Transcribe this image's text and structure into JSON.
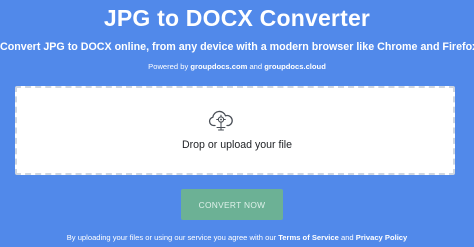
{
  "header": {
    "title": "JPG to DOCX Converter",
    "subtitle": "Convert JPG to DOCX online, from any device with a modern browser like Chrome and Firefox.",
    "powered_prefix": "Powered by ",
    "powered_link1": "groupdocs.com",
    "powered_and": " and ",
    "powered_link2": "groupdocs.cloud"
  },
  "upload": {
    "label": "Drop or upload your file",
    "icon": "cloud-upload-icon"
  },
  "actions": {
    "convert_label": "CONVERT NOW"
  },
  "footer": {
    "prefix": "By uploading your files or using our service you agree with our ",
    "terms_link": "Terms of Service",
    "and": " and ",
    "privacy_link": "Privacy Policy"
  },
  "colors": {
    "background": "#5189ea",
    "convert_button": "#6cb195",
    "dropzone_border": "#cfd6e0"
  }
}
